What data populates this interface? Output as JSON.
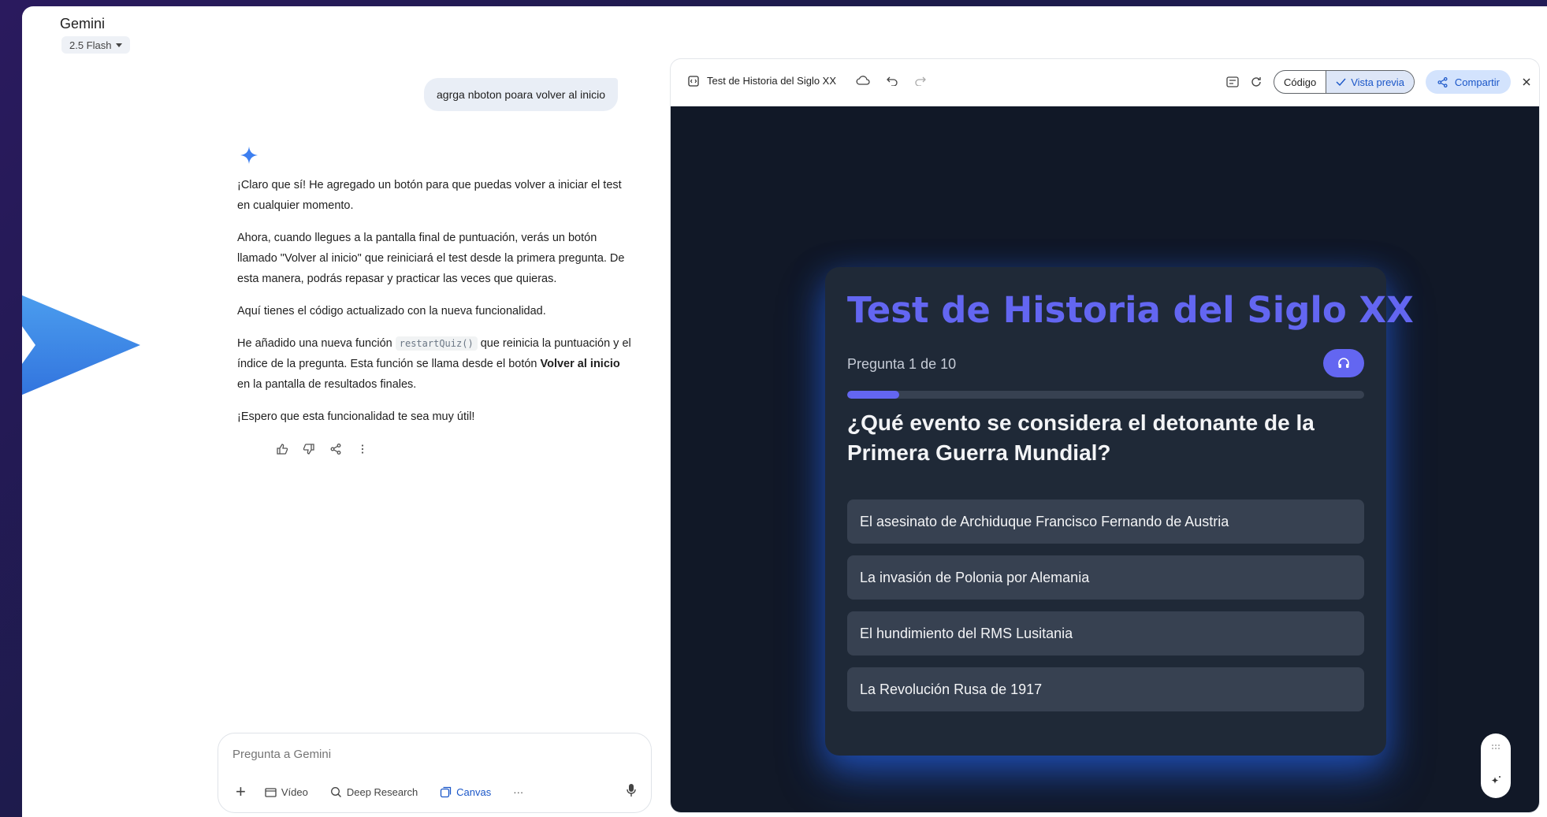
{
  "app": {
    "name": "Gemini",
    "model": "2.5 Flash"
  },
  "chat": {
    "user_message": "agrga nboton poara volver al inicio",
    "answer": {
      "p1": "¡Claro que sí! He agregado un botón para que puedas volver a iniciar el test en cualquier momento.",
      "p2": "Ahora, cuando llegues a la pantalla final de puntuación, verás un botón llamado \"Volver al inicio\" que reiniciará el test desde la primera pregunta. De esta manera, podrás repasar y practicar las veces que quieras.",
      "p3": "Aquí tienes el código actualizado con la nueva funcionalidad.",
      "p4_pre": "He añadido una nueva función",
      "p4_code": "restartQuiz()",
      "p4_mid": "que reinicia la puntuación y el índice de la pregunta. Esta función se llama desde el botón",
      "p4_bold": "Volver al inicio",
      "p4_post": "en la pantalla de resultados finales.",
      "p5": "¡Espero que esta funcionalidad te sea muy útil!"
    }
  },
  "composer": {
    "placeholder": "Pregunta a Gemini",
    "tools": [
      "Vídeo",
      "Deep Research",
      "Canvas"
    ],
    "more": "···"
  },
  "panel": {
    "title": "Test de Historia del Siglo XX",
    "code_label": "Código",
    "preview_label": "Vista previa",
    "share_label": "Compartir"
  },
  "quiz": {
    "title": "Test de Historia del Siglo XX",
    "progress_text": "Pregunta 1 de 10",
    "progress_fraction": 0.1,
    "question": "¿Qué evento se considera el detonante de la Primera Guerra Mundial?",
    "options": [
      "El asesinato de Archiduque Francisco Fernando de Austria",
      "La invasión de Polonia por Alemania",
      "El hundimiento del RMS Lusitania",
      "La Revolución Rusa de 1917"
    ]
  },
  "colors": {
    "accent": "#6366f1",
    "preview_bg": "#111827",
    "card_bg": "#1f2937",
    "option_bg": "#374151",
    "link_blue": "#1a56c8"
  }
}
